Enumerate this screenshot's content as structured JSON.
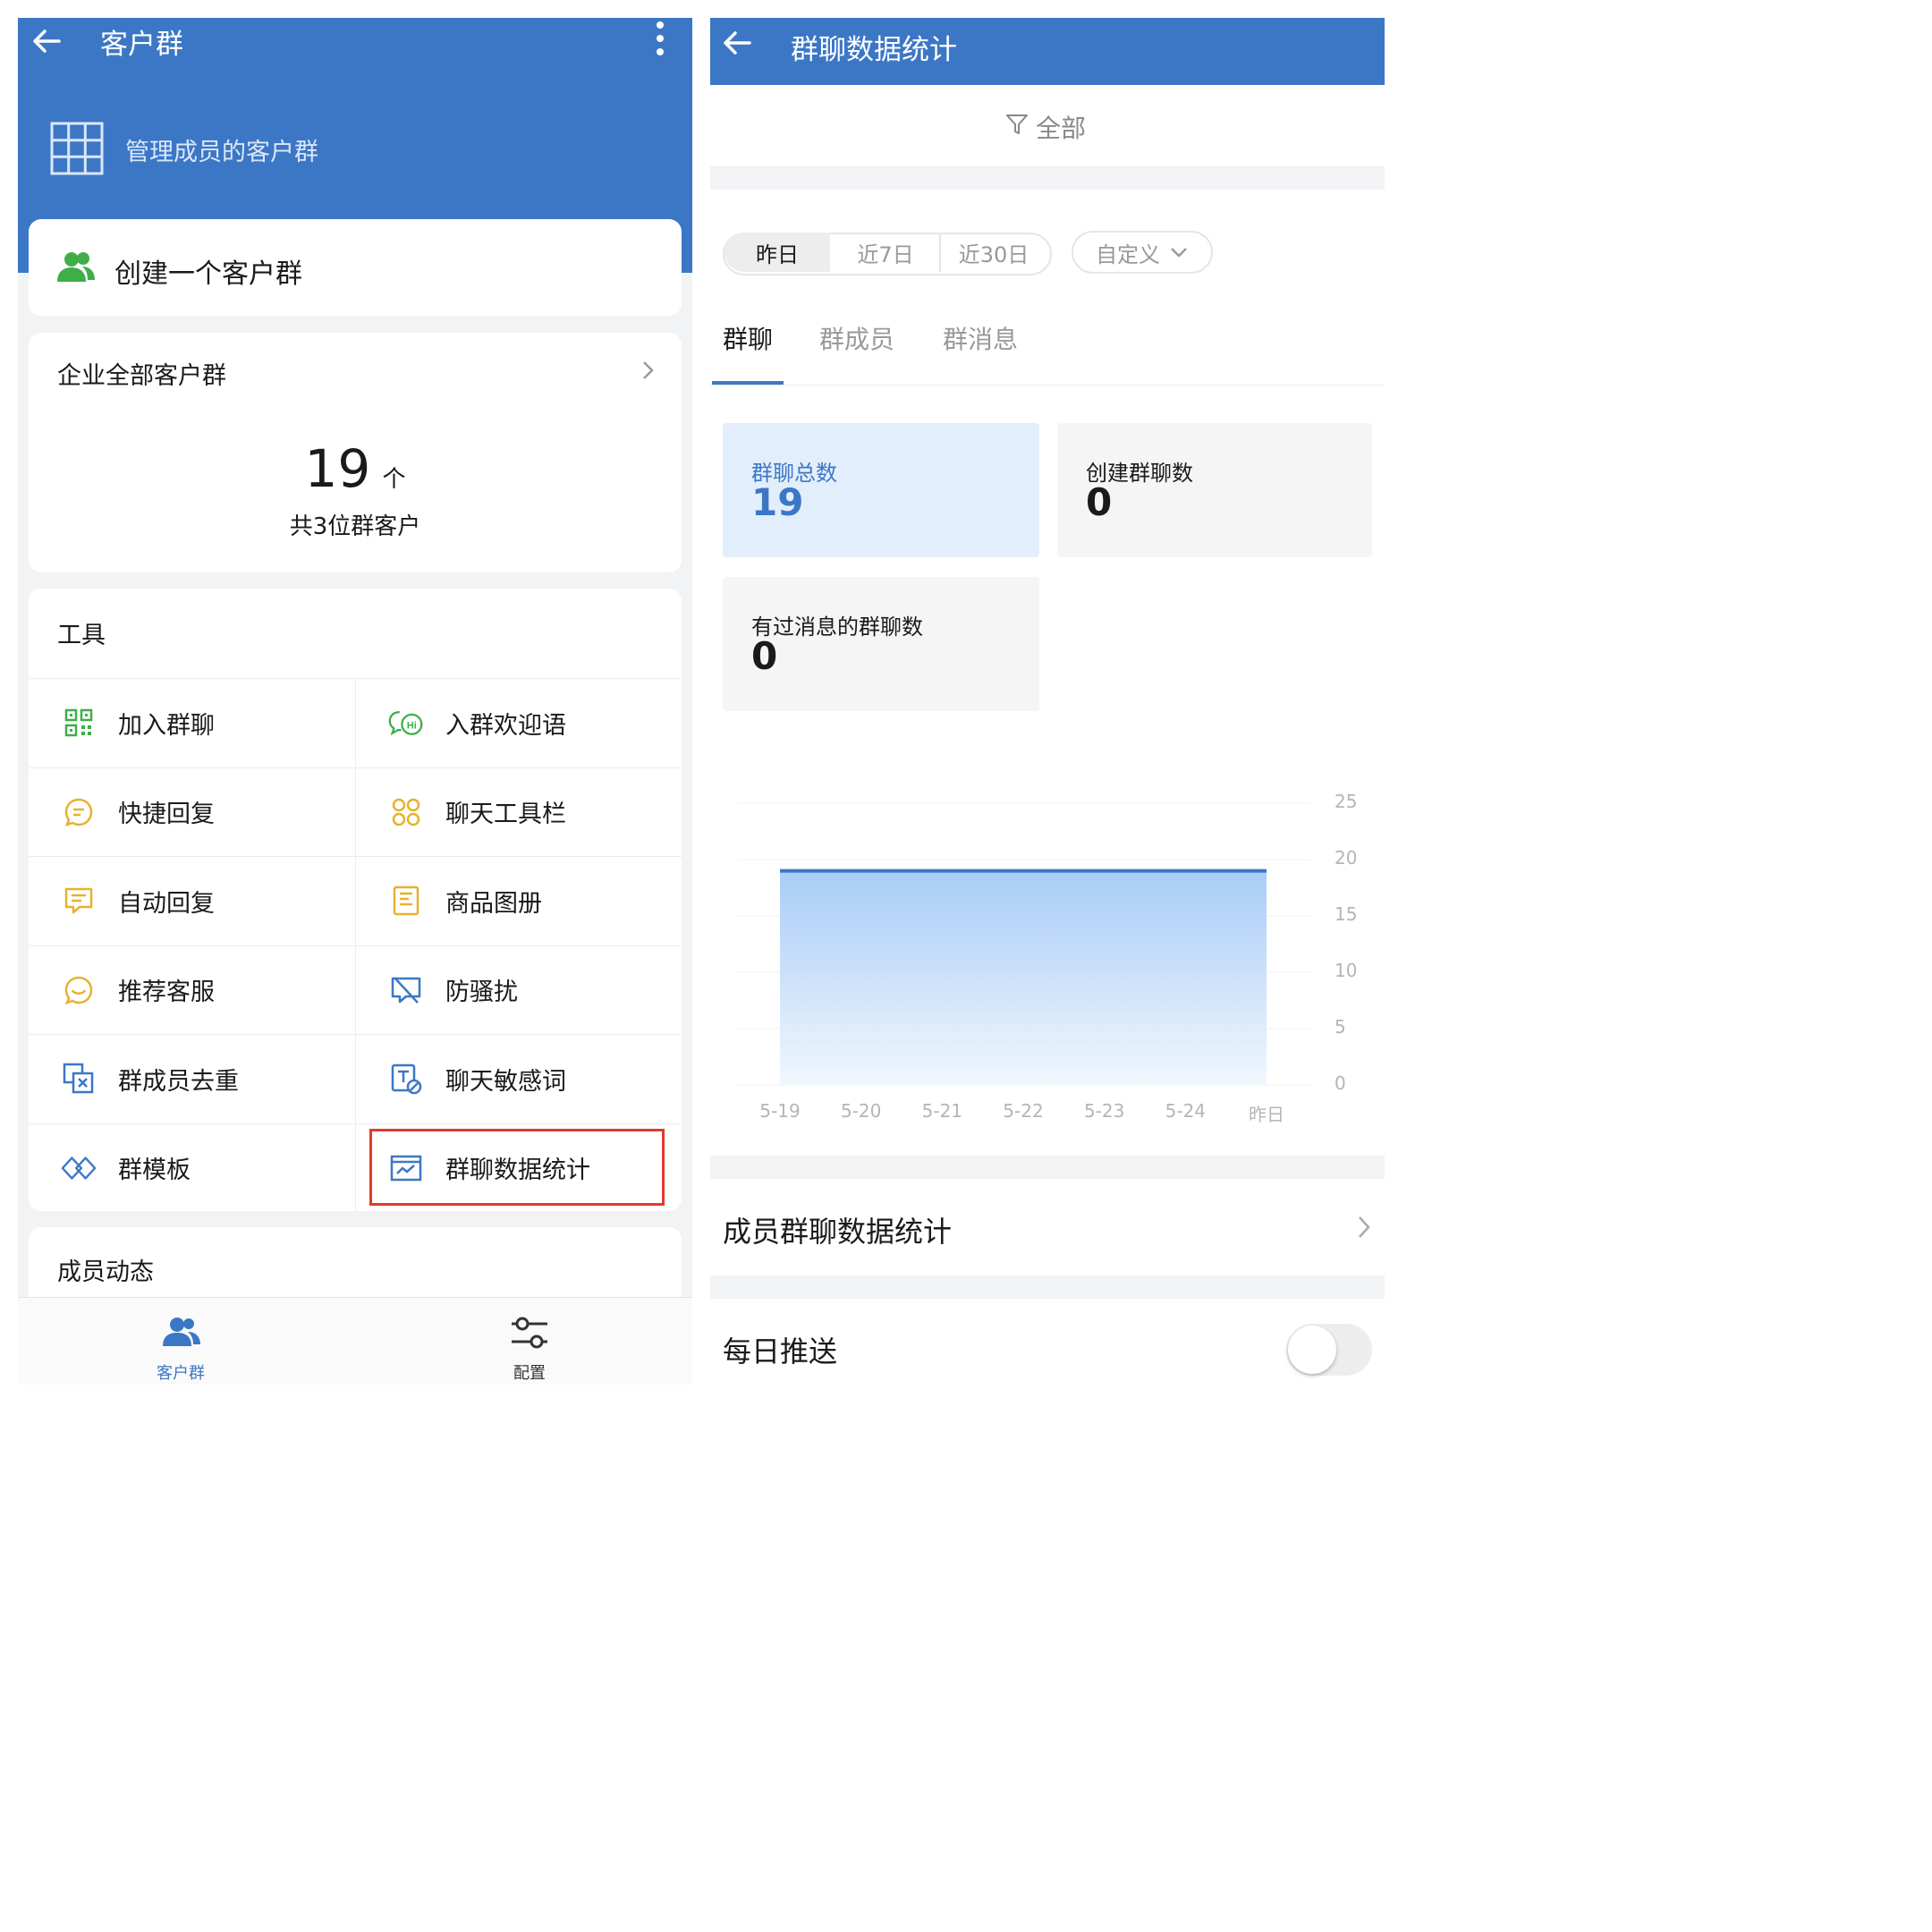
{
  "left": {
    "header": {
      "title": "客户群"
    },
    "banner": {
      "title": "管理成员的客户群"
    },
    "create": {
      "label": "创建一个客户群"
    },
    "summary": {
      "title": "企业全部客户群",
      "count": "19",
      "unit": "个",
      "sub": "共3位群客户"
    },
    "tools": {
      "title": "工具",
      "items": [
        {
          "label": "加入群聊",
          "icon": "qr-code-icon"
        },
        {
          "label": "入群欢迎语",
          "icon": "welcome-chat-icon"
        },
        {
          "label": "快捷回复",
          "icon": "quick-reply-icon"
        },
        {
          "label": "聊天工具栏",
          "icon": "chat-toolbar-icon"
        },
        {
          "label": "自动回复",
          "icon": "auto-reply-icon"
        },
        {
          "label": "商品图册",
          "icon": "product-album-icon"
        },
        {
          "label": "推荐客服",
          "icon": "recommend-service-icon"
        },
        {
          "label": "防骚扰",
          "icon": "anti-harassment-icon"
        },
        {
          "label": "群成员去重",
          "icon": "member-dedup-icon"
        },
        {
          "label": "聊天敏感词",
          "icon": "sensitive-words-icon"
        },
        {
          "label": "群模板",
          "icon": "group-template-icon"
        },
        {
          "label": "群聊数据统计",
          "icon": "group-stats-icon"
        }
      ]
    },
    "dynamics": {
      "title": "成员动态"
    },
    "bottom_nav": [
      {
        "label": "客户群",
        "icon": "customer-group-icon",
        "active": true
      },
      {
        "label": "配置",
        "icon": "settings-sliders-icon",
        "active": false
      }
    ],
    "colors": {
      "header_blue": "#3c77c6",
      "highlight_red": "#e03b2b",
      "icon_yellow": "#e8b12d",
      "icon_green": "#3fae49",
      "icon_blue": "#3c77c6"
    }
  },
  "right": {
    "header": {
      "title": "群聊数据统计"
    },
    "filter": {
      "label": "全部"
    },
    "ranges": [
      "昨日",
      "近7日",
      "近30日",
      "自定义"
    ],
    "tabs": [
      "群聊",
      "群成员",
      "群消息"
    ],
    "stats": [
      {
        "title": "群聊总数",
        "value": "19"
      },
      {
        "title": "创建群聊数",
        "value": "0"
      },
      {
        "title": "有过消息的群聊数",
        "value": "0"
      }
    ],
    "member_stats": {
      "label": "成员群聊数据统计"
    },
    "daily_push": {
      "label": "每日推送",
      "enabled": false
    }
  },
  "chart_data": {
    "type": "area",
    "categories": [
      "5-19",
      "5-20",
      "5-21",
      "5-22",
      "5-23",
      "5-24",
      "昨日"
    ],
    "series": [
      {
        "values": [
          19,
          19,
          19,
          19,
          19,
          19,
          19
        ]
      }
    ],
    "ylim": [
      0,
      25
    ],
    "yticks": [
      25,
      20,
      15,
      10,
      5,
      0
    ],
    "grid": true,
    "ylabel": "",
    "xlabel": "",
    "title": ""
  }
}
